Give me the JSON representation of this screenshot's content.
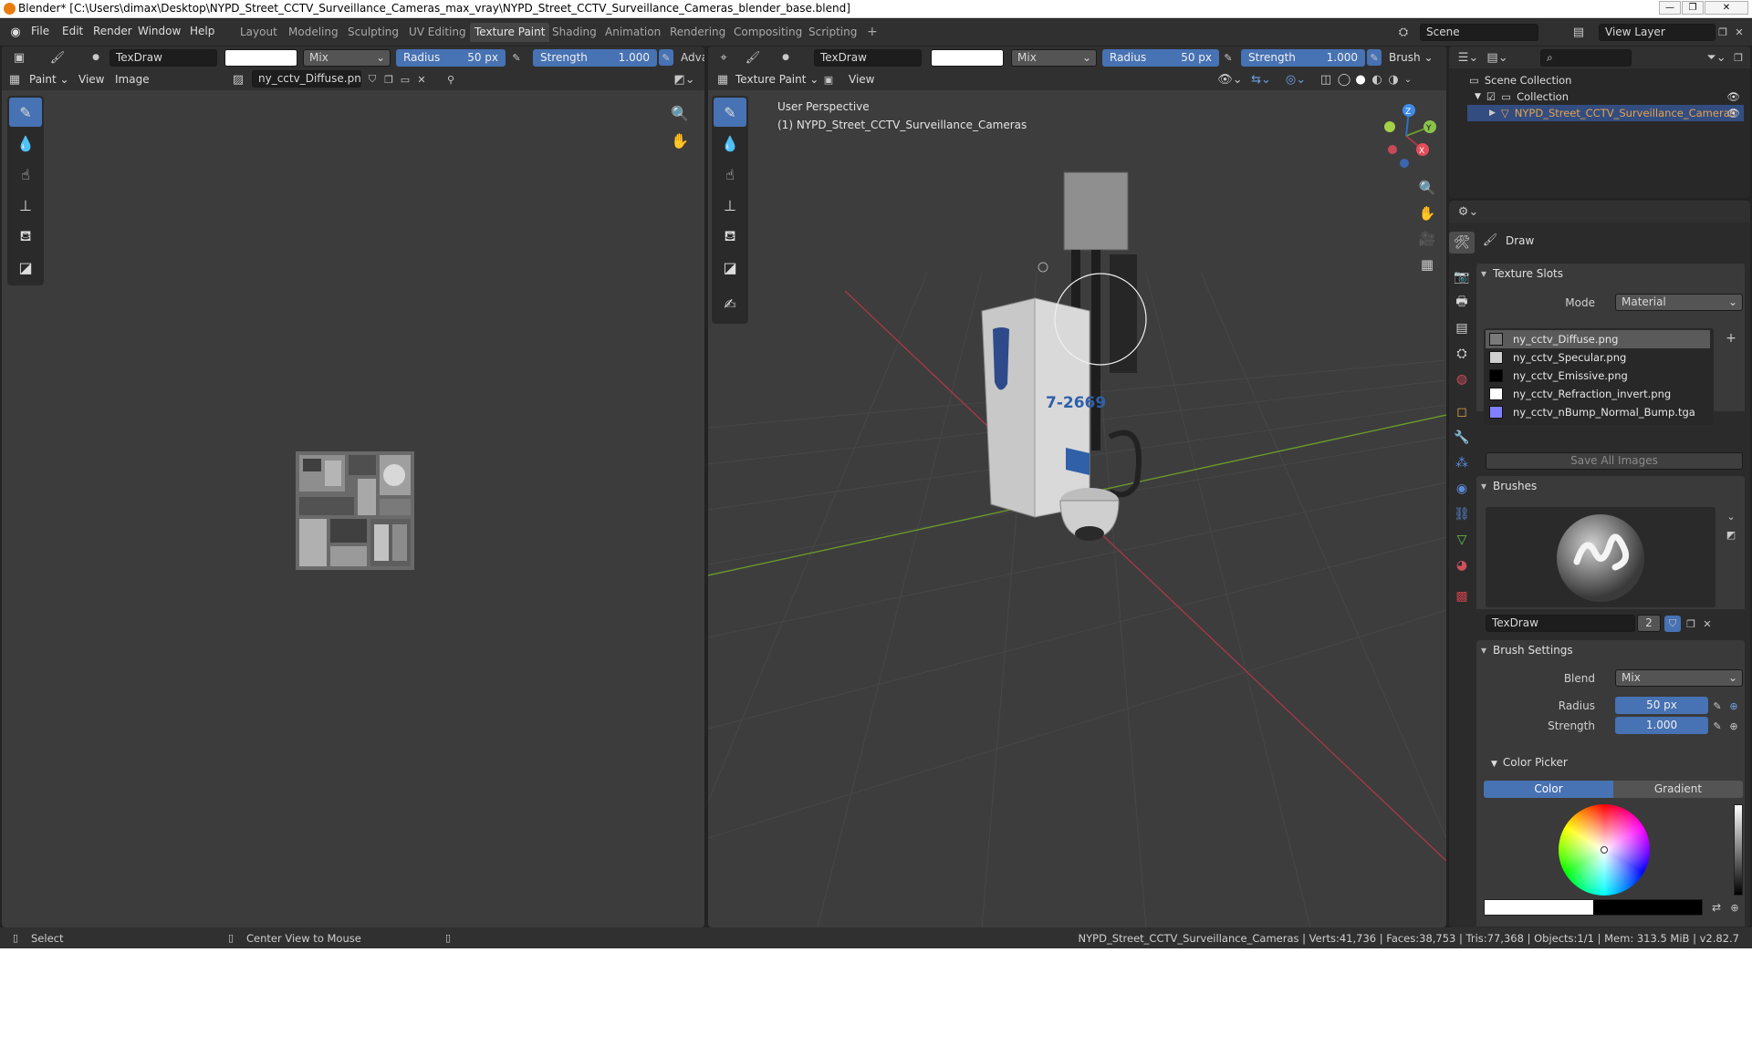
{
  "window": {
    "title": "Blender* [C:\\Users\\dimax\\Desktop\\NYPD_Street_CCTV_Surveillance_Cameras_max_vray\\NYPD_Street_CCTV_Surveillance_Cameras_blender_base.blend]",
    "controls": [
      "—",
      "❐",
      "✕"
    ]
  },
  "menus": [
    "File",
    "Edit",
    "Render",
    "Window",
    "Help"
  ],
  "workspaces": [
    "Layout",
    "Modeling",
    "Sculpting",
    "UV Editing",
    "Texture Paint",
    "Shading",
    "Animation",
    "Rendering",
    "Compositing",
    "Scripting",
    "+"
  ],
  "active_workspace": "Texture Paint",
  "scene": {
    "name": "Scene",
    "view_layer": "View Layer"
  },
  "image_editor": {
    "brush_name": "TexDraw",
    "blend": "Mix",
    "radius_label": "Radius",
    "radius_value": "50 px",
    "strength_label": "Strength",
    "strength_value": "1.000",
    "adv": "Adva",
    "mode": "Paint",
    "view": "View",
    "image_menu": "Image",
    "image_name": "ny_cctv_Diffuse.png"
  },
  "viewport": {
    "brush_name": "TexDraw",
    "blend": "Mix",
    "radius_label": "Radius",
    "radius_value": "50 px",
    "strength_label": "Strength",
    "strength_value": "1.000",
    "brush_menu": "Brush",
    "mode": "Texture Paint",
    "view": "View",
    "perspective": "User Perspective",
    "object_info": "(1) NYPD_Street_CCTV_Surveillance_Cameras",
    "box_number": "7-2669",
    "axes": {
      "x": "X",
      "y": "Y",
      "z": "Z"
    },
    "colors": {
      "x_axis": "#a3384a",
      "y_axis": "#6b9a2a",
      "z_axis": "#2f6ec7",
      "x_neg": "#6a2a34"
    }
  },
  "outliner": {
    "root": "Scene Collection",
    "collection": "Collection",
    "object": "NYPD_Street_CCTV_Surveillance_Cameras"
  },
  "properties": {
    "tool_name": "Draw",
    "texture_slots": {
      "title": "Texture Slots",
      "mode_label": "Mode",
      "mode_value": "Material",
      "slots": [
        {
          "name": "ny_cctv_Diffuse.png",
          "color": "#7a7a7a",
          "selected": true
        },
        {
          "name": "ny_cctv_Specular.png",
          "color": "#cfcfcf",
          "selected": false
        },
        {
          "name": "ny_cctv_Emissive.png",
          "color": "#000000",
          "selected": false
        },
        {
          "name": "ny_cctv_Refraction_invert.png",
          "color": "#ffffff",
          "selected": false
        },
        {
          "name": "ny_cctv_nBump_Normal_Bump.tga",
          "color": "#8080ff",
          "selected": false
        }
      ],
      "save_all": "Save All Images"
    },
    "brushes": {
      "title": "Brushes",
      "brush_name": "TexDraw",
      "users": "2"
    },
    "brush_settings": {
      "title": "Brush Settings",
      "blend_label": "Blend",
      "blend_value": "Mix",
      "radius_label": "Radius",
      "radius_value": "50 px",
      "strength_label": "Strength",
      "strength_value": "1.000"
    },
    "color_picker": {
      "title": "Color Picker",
      "tab_color": "Color",
      "tab_gradient": "Gradient"
    }
  },
  "statusbar": {
    "select": "Select",
    "center_view": "Center View to Mouse",
    "stats": "NYPD_Street_CCTV_Surveillance_Cameras | Verts:41,736 | Faces:38,753 | Tris:77,368 | Objects:1/1 | Mem: 313.5 MiB | v2.82.7"
  },
  "accent": "#4772b3"
}
